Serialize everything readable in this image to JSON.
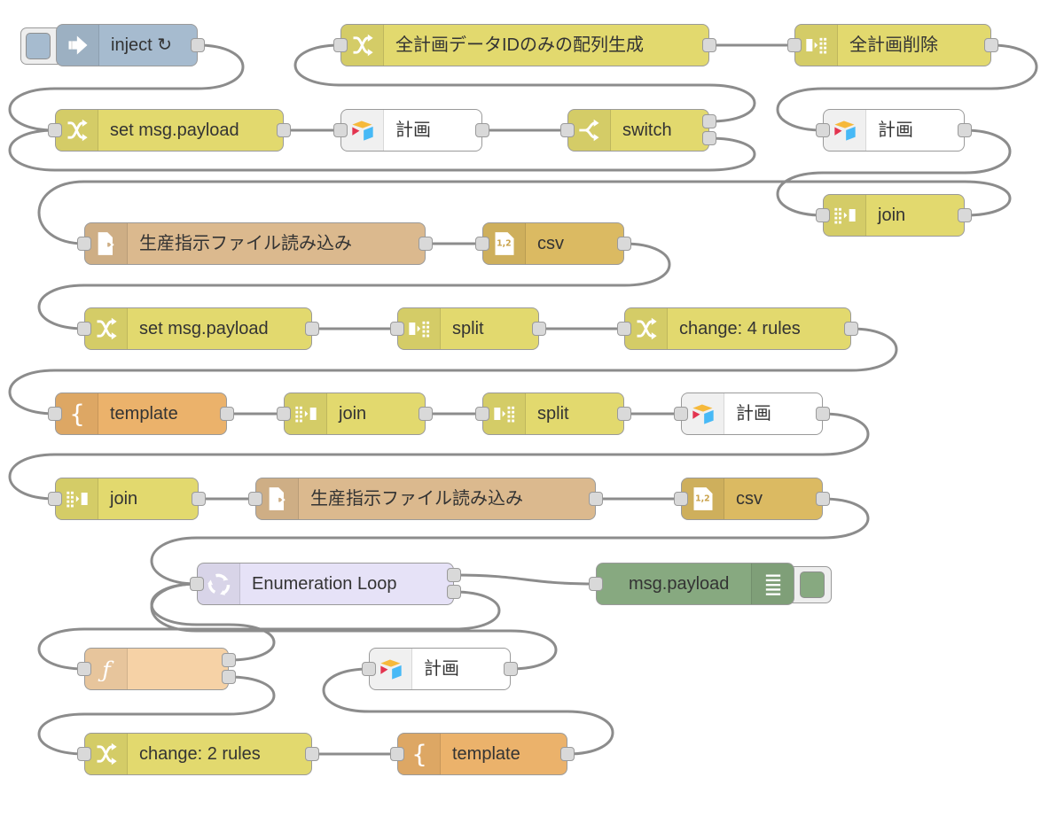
{
  "editor": {
    "canvas_background": "#ffffff",
    "wire_color": "#8c8c8c"
  },
  "nodes": [
    {
      "id": "n1",
      "type": "inject",
      "label": "inject ↻",
      "icon": "arrow-right-icon",
      "color": "#a6bbcf",
      "outputs": 1,
      "button": true
    },
    {
      "id": "n2",
      "type": "change",
      "label": "全計画データIDのみの配列生成",
      "icon": "shuffle-icon",
      "color": "#e2d96e",
      "outputs": 1
    },
    {
      "id": "n3",
      "type": "split",
      "label": "全計画削除",
      "icon": "split-icon",
      "color": "#e2d96e",
      "outputs": 1
    },
    {
      "id": "n4",
      "type": "change",
      "label": "set msg.payload",
      "icon": "shuffle-icon",
      "color": "#e2d96e",
      "outputs": 1
    },
    {
      "id": "n5",
      "type": "airtable",
      "label": "計画",
      "icon": "airtable-icon",
      "color": "#ffffff",
      "outputs": 1
    },
    {
      "id": "n6",
      "type": "switch",
      "label": "switch",
      "icon": "switch-icon",
      "color": "#e2d96e",
      "outputs": 2
    },
    {
      "id": "n7",
      "type": "airtable",
      "label": "計画",
      "icon": "airtable-icon",
      "color": "#ffffff",
      "outputs": 1
    },
    {
      "id": "n8",
      "type": "join",
      "label": "join",
      "icon": "join-icon",
      "color": "#e2d96e",
      "outputs": 1
    },
    {
      "id": "n9",
      "type": "file in",
      "label": "生産指示ファイル読み込み",
      "icon": "file-in-icon",
      "color": "#dbb98e",
      "outputs": 1
    },
    {
      "id": "n10",
      "type": "csv",
      "label": "csv",
      "icon": "csv-icon",
      "color": "#dbba62",
      "outputs": 1
    },
    {
      "id": "n11",
      "type": "change",
      "label": "set msg.payload",
      "icon": "shuffle-icon",
      "color": "#e2d96e",
      "outputs": 1
    },
    {
      "id": "n12",
      "type": "split",
      "label": "split",
      "icon": "split-icon",
      "color": "#e2d96e",
      "outputs": 1
    },
    {
      "id": "n13",
      "type": "change",
      "label": "change: 4 rules",
      "icon": "shuffle-icon",
      "color": "#e2d96e",
      "outputs": 1
    },
    {
      "id": "n14",
      "type": "template",
      "label": "template",
      "icon": "template-brace-icon",
      "color": "#ebb26b",
      "outputs": 1
    },
    {
      "id": "n15",
      "type": "join",
      "label": "join",
      "icon": "join-icon",
      "color": "#e2d96e",
      "outputs": 1
    },
    {
      "id": "n16",
      "type": "split",
      "label": "split",
      "icon": "split-icon",
      "color": "#e2d96e",
      "outputs": 1
    },
    {
      "id": "n17",
      "type": "airtable",
      "label": "計画",
      "icon": "airtable-icon",
      "color": "#ffffff",
      "outputs": 1
    },
    {
      "id": "n18",
      "type": "join",
      "label": "join",
      "icon": "join-icon",
      "color": "#e2d96e",
      "outputs": 1
    },
    {
      "id": "n19",
      "type": "file in",
      "label": "生産指示ファイル読み込み",
      "icon": "file-in-icon",
      "color": "#dbb98e",
      "outputs": 1
    },
    {
      "id": "n20",
      "type": "csv",
      "label": "csv",
      "icon": "csv-icon",
      "color": "#dbba62",
      "outputs": 1
    },
    {
      "id": "n21",
      "type": "loop",
      "label": "Enumeration Loop",
      "icon": "loop-arrows-icon",
      "color": "#e6e2f7",
      "outputs": 2
    },
    {
      "id": "n22",
      "type": "debug",
      "label": "msg.payload",
      "icon": "list-icon",
      "color": "#87a980",
      "outputs": 0,
      "button": true
    },
    {
      "id": "n23",
      "type": "function",
      "label": "",
      "icon": "function-icon",
      "color": "#f6d2a6",
      "outputs": 2
    },
    {
      "id": "n24",
      "type": "airtable",
      "label": "計画",
      "icon": "airtable-icon",
      "color": "#ffffff",
      "outputs": 1
    },
    {
      "id": "n25",
      "type": "change",
      "label": "change: 2 rules",
      "icon": "shuffle-icon",
      "color": "#e2d96e",
      "outputs": 1
    },
    {
      "id": "n26",
      "type": "template",
      "label": "template",
      "icon": "template-brace-icon",
      "color": "#ebb26b",
      "outputs": 1
    }
  ],
  "wires": [
    {
      "from": "n1",
      "port": 0,
      "to": "n4"
    },
    {
      "from": "n4",
      "port": 0,
      "to": "n5"
    },
    {
      "from": "n5",
      "port": 0,
      "to": "n6"
    },
    {
      "from": "n6",
      "port": 0,
      "to": "n2"
    },
    {
      "from": "n2",
      "port": 0,
      "to": "n3"
    },
    {
      "from": "n3",
      "port": 0,
      "to": "n7"
    },
    {
      "from": "n7",
      "port": 0,
      "to": "n8"
    },
    {
      "from": "n6",
      "port": 1,
      "to": "n4"
    },
    {
      "from": "n8",
      "port": 0,
      "to": "n9"
    },
    {
      "from": "n9",
      "port": 0,
      "to": "n10"
    },
    {
      "from": "n10",
      "port": 0,
      "to": "n11"
    },
    {
      "from": "n11",
      "port": 0,
      "to": "n12"
    },
    {
      "from": "n12",
      "port": 0,
      "to": "n13"
    },
    {
      "from": "n13",
      "port": 0,
      "to": "n14"
    },
    {
      "from": "n14",
      "port": 0,
      "to": "n15"
    },
    {
      "from": "n15",
      "port": 0,
      "to": "n16"
    },
    {
      "from": "n16",
      "port": 0,
      "to": "n17"
    },
    {
      "from": "n17",
      "port": 0,
      "to": "n18"
    },
    {
      "from": "n18",
      "port": 0,
      "to": "n19"
    },
    {
      "from": "n19",
      "port": 0,
      "to": "n20"
    },
    {
      "from": "n20",
      "port": 0,
      "to": "n21"
    },
    {
      "from": "n21",
      "port": 0,
      "to": "n22"
    },
    {
      "from": "n21",
      "port": 1,
      "to": "n23"
    },
    {
      "from": "n23",
      "port": 0,
      "to": "n21"
    },
    {
      "from": "n23",
      "port": 1,
      "to": "n25"
    },
    {
      "from": "n25",
      "port": 0,
      "to": "n26"
    },
    {
      "from": "n26",
      "port": 0,
      "to": "n24"
    },
    {
      "from": "n24",
      "port": 0,
      "to": "n21"
    }
  ]
}
